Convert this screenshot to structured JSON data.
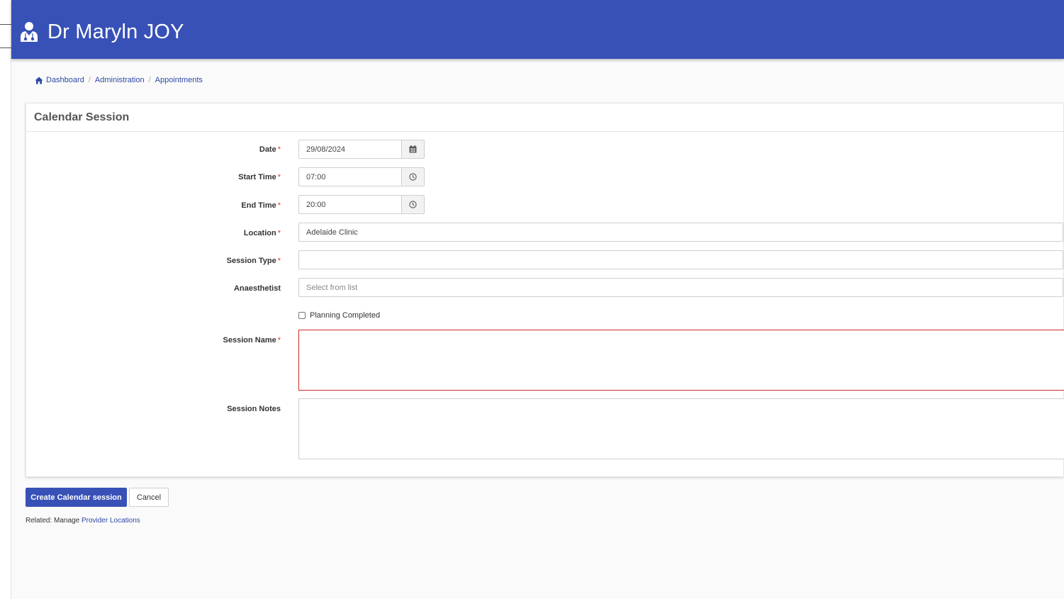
{
  "header": {
    "title": "Dr Maryln JOY",
    "icon": "doctor-icon",
    "background": "#3751b7"
  },
  "breadcrumb": [
    {
      "label": "Dashboard",
      "icon": "home-icon"
    },
    {
      "label": "Administration"
    },
    {
      "label": "Appointments"
    }
  ],
  "card": {
    "title": "Calendar Session"
  },
  "form": {
    "date": {
      "label": "Date",
      "value": "29/08/2024",
      "icon": "calendar-icon"
    },
    "start_time": {
      "label": "Start Time",
      "value": "07:00",
      "icon": "clock-icon"
    },
    "end_time": {
      "label": "End Time",
      "value": "20:00",
      "icon": "clock-icon"
    },
    "location": {
      "label": "Location",
      "value": "Adelaide Clinic"
    },
    "session_type": {
      "label": "Session Type",
      "value": ""
    },
    "anaesthetist": {
      "label": "Anaesthetist",
      "placeholder": "Select from list"
    },
    "planning_completed": {
      "label": "Planning Completed",
      "checked": false
    },
    "session_name": {
      "label": "Session Name",
      "value": ""
    },
    "session_notes": {
      "label": "Session Notes",
      "value": ""
    },
    "required_marker": "*"
  },
  "actions": {
    "create_label": "Create Calendar session",
    "cancel_label": "Cancel"
  },
  "related": {
    "prefix": "Related: Manage",
    "link": "Provider Locations"
  },
  "colors": {
    "brand": "#3751b7",
    "link": "#2f4aa6",
    "error": "#cc2b2b",
    "required": "#d33333"
  }
}
